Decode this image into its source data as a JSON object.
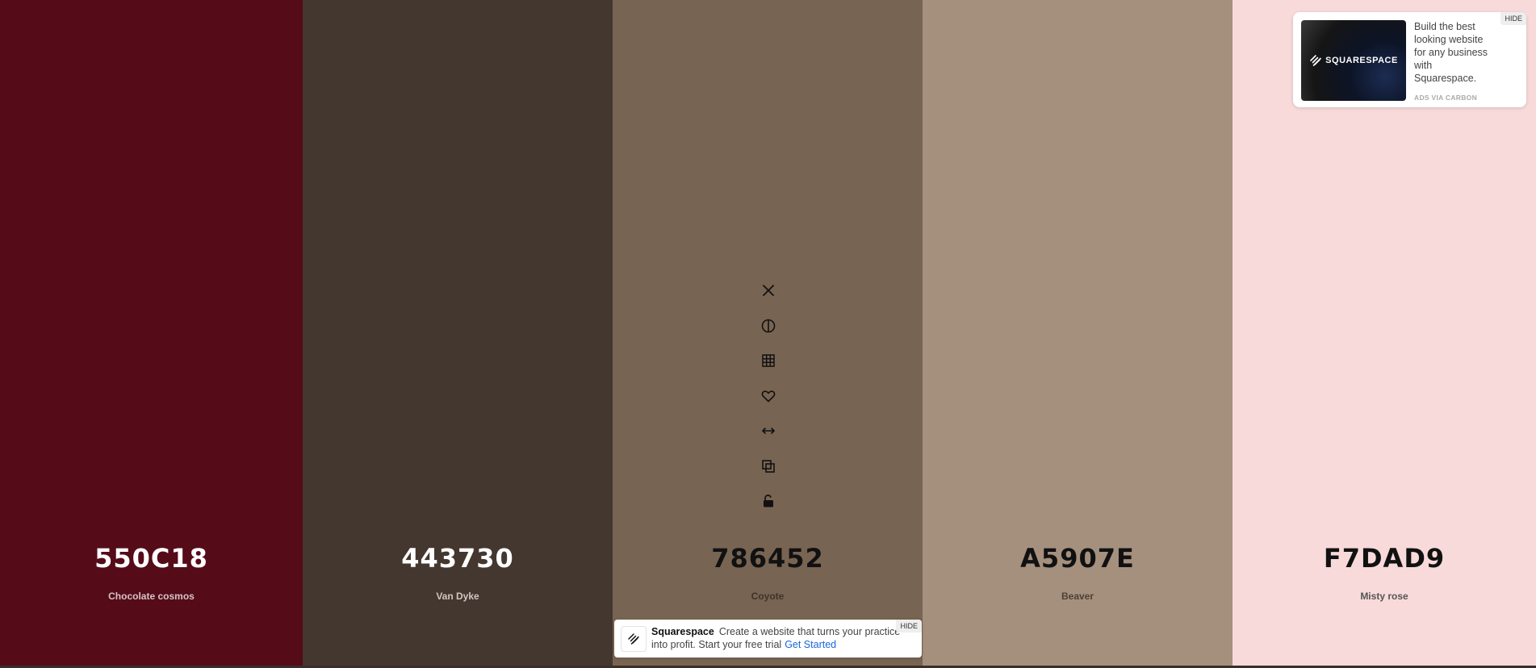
{
  "palette": [
    {
      "hex": "550C18",
      "name": "Chocolate cosmos",
      "color": "#550C18",
      "width": 375,
      "hex_color": "#ffffff",
      "name_color": "#d5c4c7"
    },
    {
      "hex": "443730",
      "name": "Van Dyke",
      "color": "#443730",
      "width": 384,
      "hex_color": "#ffffff",
      "name_color": "#cfc6c1"
    },
    {
      "hex": "786452",
      "name": "Coyote",
      "color": "#786452",
      "width": 384,
      "hex_color": "#111111",
      "name_color": "#3e3329"
    },
    {
      "hex": "A5907E",
      "name": "Beaver",
      "color": "#A5907E",
      "width": 384,
      "hex_color": "#111111",
      "name_color": "#4d4034"
    },
    {
      "hex": "F7DAD9",
      "name": "Misty rose",
      "color": "#F7DAD9",
      "width": 376,
      "hex_color": "#111111",
      "name_color": "#555555"
    }
  ],
  "tools": [
    {
      "name": "remove-color-icon",
      "title": "Remove color"
    },
    {
      "name": "shades-icon",
      "title": "View shades"
    },
    {
      "name": "grid-icon",
      "title": "Palette grid"
    },
    {
      "name": "heart-icon",
      "title": "Save color"
    },
    {
      "name": "drag-icon",
      "title": "Drag"
    },
    {
      "name": "copy-icon",
      "title": "Copy hex"
    },
    {
      "name": "lock-icon",
      "title": "Toggle lock"
    }
  ],
  "ad_top": {
    "brand": "SQUARESPACE",
    "text": "Build the best looking website for any business with Squarespace.",
    "via": "ADS VIA CARBON",
    "hide": "HIDE"
  },
  "ad_bottom": {
    "brand": "Squarespace",
    "text": "Create a website that turns your practice into profit. Start your free trial",
    "cta": "Get Started",
    "hide": "HIDE"
  }
}
